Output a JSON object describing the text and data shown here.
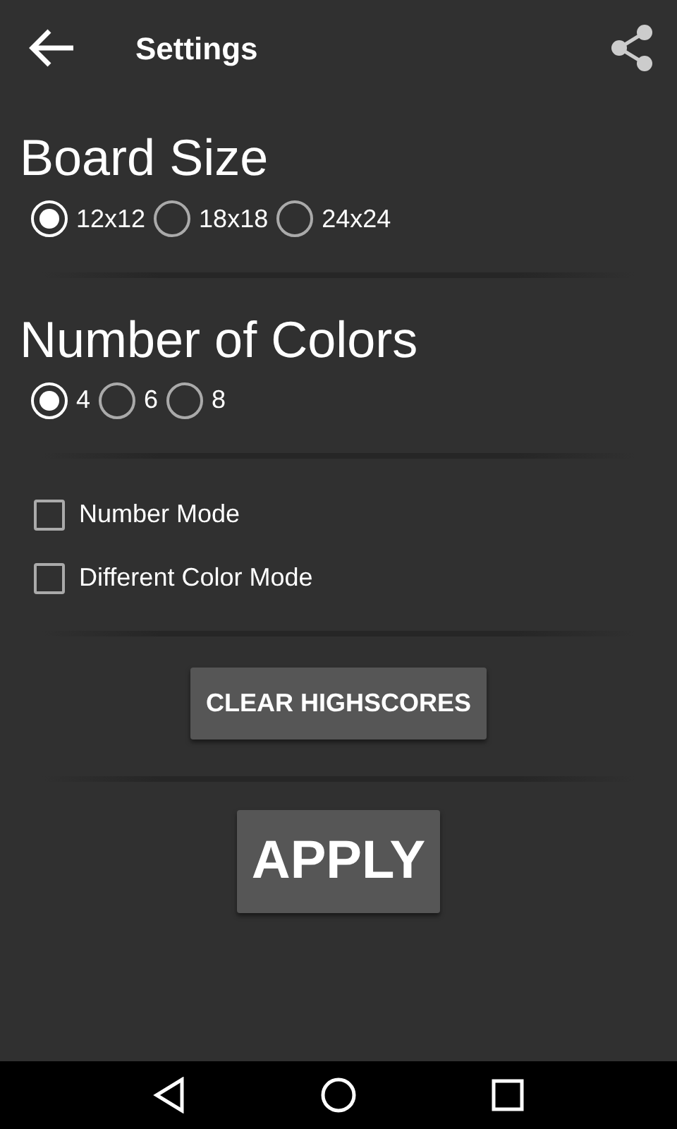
{
  "toolbar": {
    "title": "Settings"
  },
  "sections": [
    {
      "kind": "radio",
      "heading": "Board Size",
      "options": [
        {
          "label": "12x12",
          "selected": true
        },
        {
          "label": "18x18",
          "selected": false
        },
        {
          "label": "24x24",
          "selected": false
        }
      ]
    },
    {
      "kind": "radio",
      "heading": "Number of Colors",
      "options": [
        {
          "label": "4",
          "selected": true
        },
        {
          "label": "6",
          "selected": false
        },
        {
          "label": "8",
          "selected": false
        }
      ]
    },
    {
      "kind": "checkbox",
      "items": [
        {
          "label": "Number Mode",
          "checked": false
        },
        {
          "label": "Different Color Mode",
          "checked": false
        }
      ]
    }
  ],
  "clear_button": "CLEAR HIGHSCORES",
  "apply_button": "APPLY"
}
